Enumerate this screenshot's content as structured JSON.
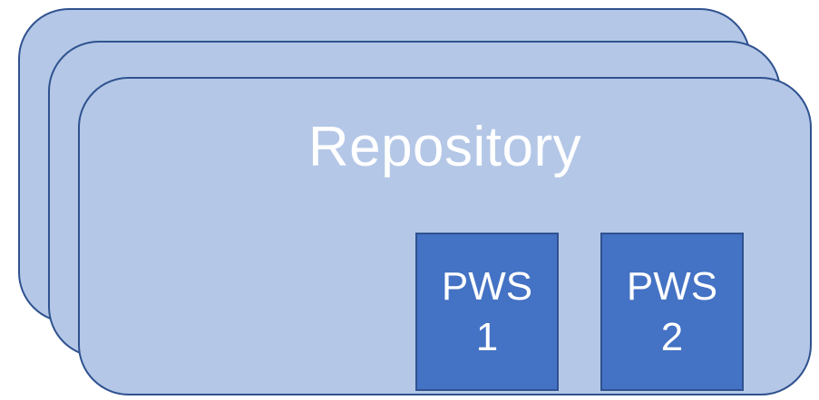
{
  "diagram": {
    "repository_label": "Repository",
    "pws_boxes": [
      {
        "line1": "PWS",
        "line2": "1"
      },
      {
        "line1": "PWS",
        "line2": "2"
      }
    ]
  },
  "colors": {
    "card_fill": "#b4c7e7",
    "card_border": "#2f528f",
    "pws_fill": "#4472c4",
    "text": "#ffffff"
  }
}
